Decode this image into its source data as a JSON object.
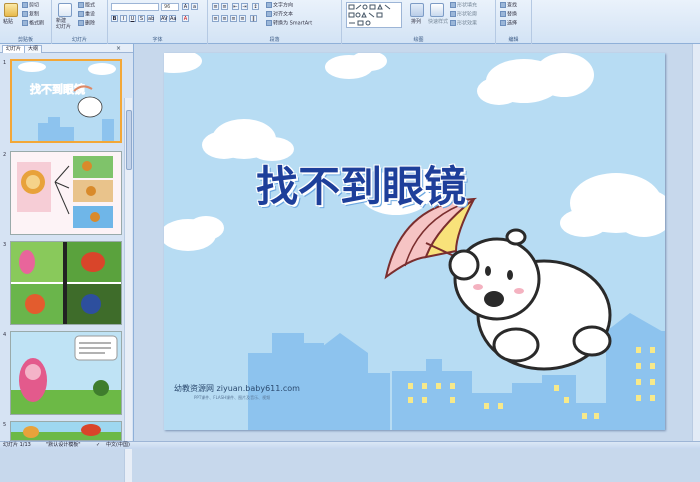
{
  "ribbon": {
    "groups": [
      {
        "label": "剪贴板"
      },
      {
        "label": "幻灯片"
      },
      {
        "label": "字体"
      },
      {
        "label": "段落"
      },
      {
        "label": "绘图"
      },
      {
        "label": "编辑"
      }
    ],
    "clipboard": {
      "paste": "粘贴",
      "cut": "剪切",
      "copy": "复制",
      "format_painter": "格式刷"
    },
    "slides": {
      "new_slide": "新建\n幻灯片",
      "layout": "版式",
      "reset": "重设",
      "delete": "删除"
    },
    "font": {
      "font_name": "",
      "font_size": "96"
    },
    "paragraph": {
      "text_direction": "文字方向",
      "align_text": "对齐文本",
      "smartart": "转换为 SmartArt"
    },
    "drawing": {
      "arrange": "排列",
      "quick_styles": "快速样式",
      "shape_fill": "形状填充",
      "shape_outline": "形状轮廓",
      "shape_effects": "形状效果"
    },
    "editing": {
      "find": "查找",
      "replace": "替换",
      "select": "选择"
    }
  },
  "panel": {
    "tabs": [
      "幻灯片",
      "大纲"
    ],
    "slide_numbers": [
      "1",
      "2",
      "3",
      "4",
      "5"
    ],
    "thumb1_title": "找不到眼镜"
  },
  "slide": {
    "title": "找不到眼镜",
    "watermark_main": "幼教资源网 ziyuan.baby611.com",
    "watermark_sub": "PPT课件、FLASH课件、图片及音乐、视频"
  },
  "status": {
    "slide_counter": "幻灯片 1/13",
    "theme": "\"默认设计模板\"",
    "language": "中文(中国)"
  },
  "colors": {
    "sky": "#b7dcf3",
    "title": "#1e3f9a",
    "building": "#8dc3ee",
    "selection": "#f3a737"
  }
}
